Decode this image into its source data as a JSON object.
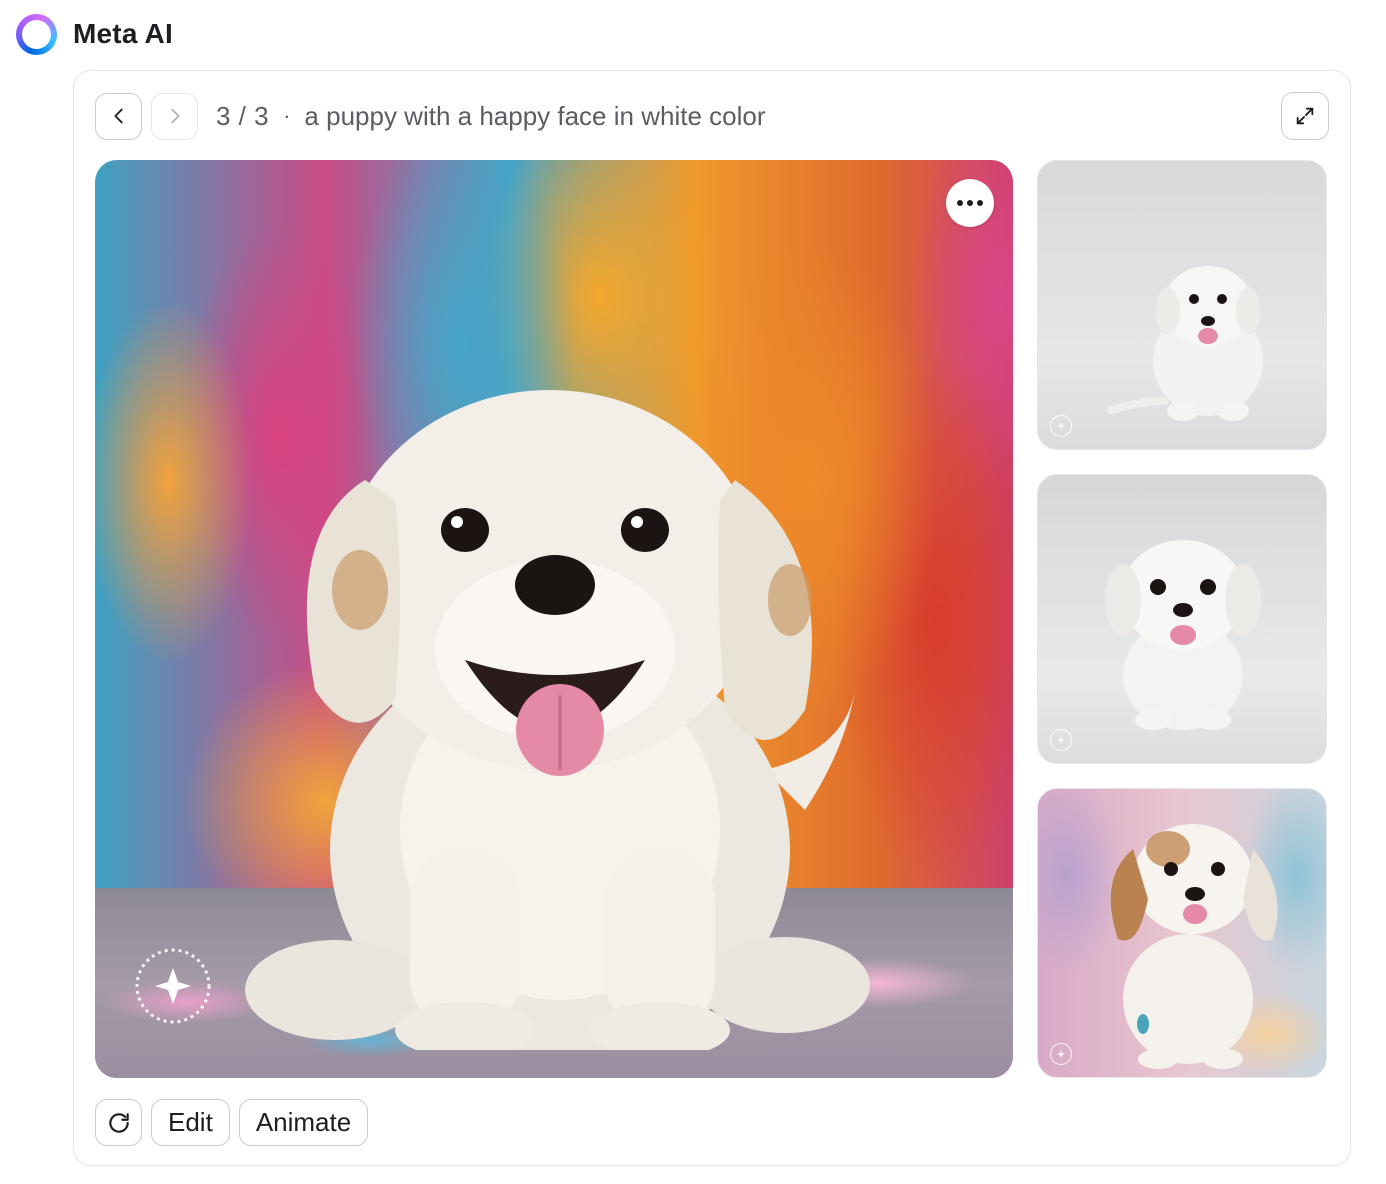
{
  "header": {
    "title": "Meta AI",
    "logo_icon": "meta-ai-ring-icon"
  },
  "viewer": {
    "counter": "3 / 3",
    "separator": "·",
    "prompt": "a puppy with a happy face in white color",
    "prev_icon": "chevron-left-icon",
    "next_icon": "chevron-right-icon",
    "expand_icon": "expand-icon",
    "more_icon": "more-horizontal-icon",
    "main_image": "white puppy sitting in front of colorful painted wall",
    "thumbnails": [
      {
        "desc": "small white puppy on gray background"
      },
      {
        "desc": "white puppy facing forward on gray background"
      },
      {
        "desc": "white and tan puppy on pastel painted background"
      }
    ]
  },
  "actions": {
    "regenerate_icon": "refresh-icon",
    "edit_label": "Edit",
    "animate_label": "Animate"
  },
  "colors": {
    "border": "#c9ccd1",
    "text": "#1c1e21",
    "muted": "#5a5d63"
  }
}
